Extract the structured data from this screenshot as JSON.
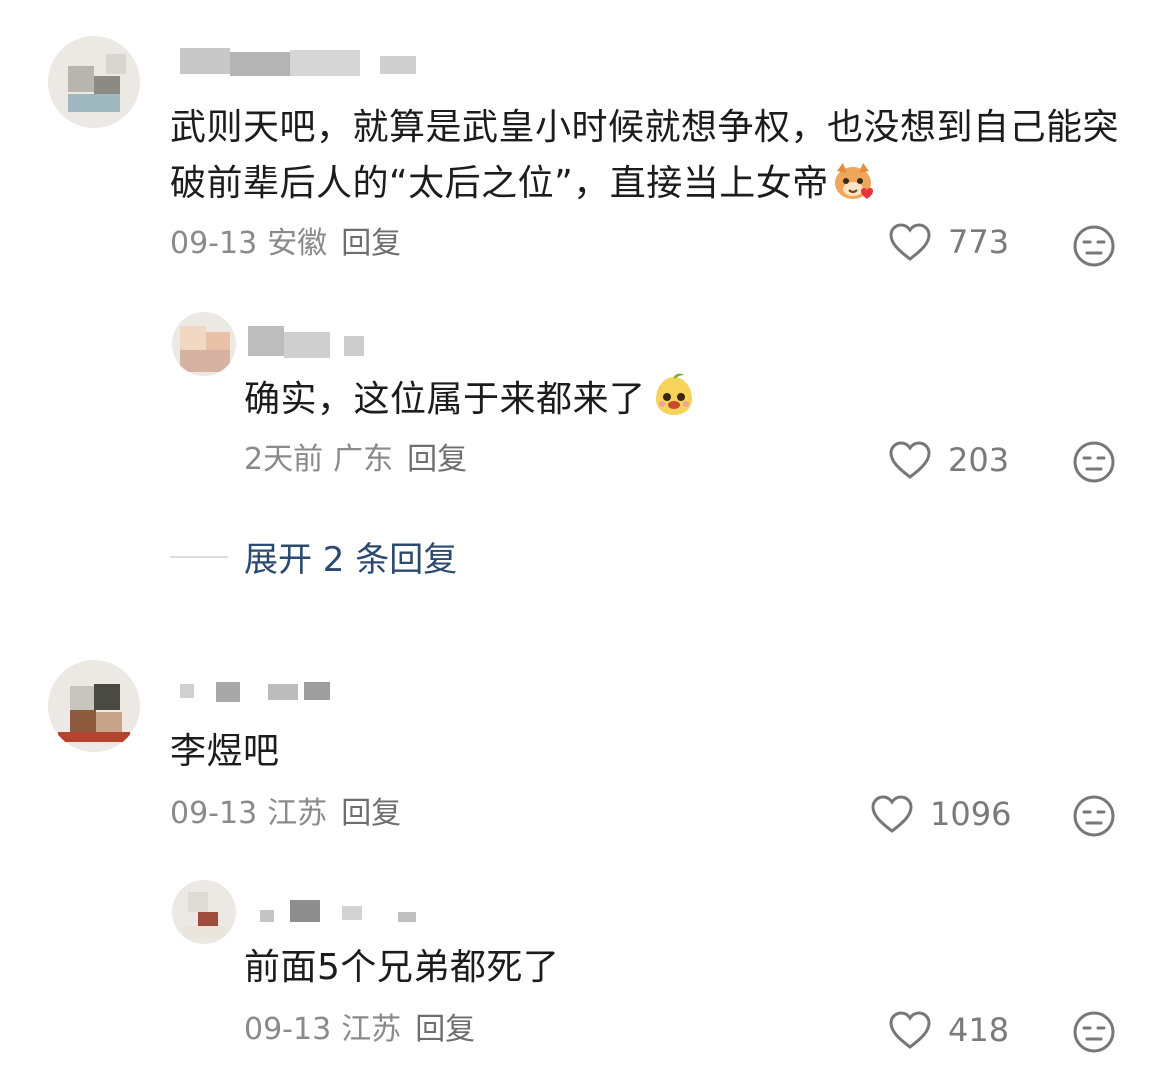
{
  "comments": [
    {
      "text": "武则天吧，就算是武皇小时候就想争权，也没想到自己能突破前辈后人的“太后之位”，直接当上女帝",
      "emoji": "tiger-heart-emoji",
      "date": "09-13",
      "location": "安徽",
      "reply_label": "回复",
      "likes": "773",
      "reply": {
        "text": "确实，这位属于来都来了",
        "emoji": "mango-smile-emoji",
        "date": "2天前",
        "location": "广东",
        "reply_label": "回复",
        "likes": "203"
      },
      "expand_label": "展开 2 条回复"
    },
    {
      "text": "李煜吧",
      "date": "09-13",
      "location": "江苏",
      "reply_label": "回复",
      "likes": "1096",
      "reply": {
        "text": "前面5个兄弟都死了",
        "date": "09-13",
        "location": "江苏",
        "reply_label": "回复",
        "likes": "418"
      }
    }
  ],
  "colors": {
    "text": "#1c1c1c",
    "meta": "#8a8a8a",
    "expand_link": "#2b4a6f",
    "icon": "#7a7a7a"
  },
  "icons": {
    "like": "heart-outline-icon",
    "dislike": "neutral-face-icon"
  }
}
